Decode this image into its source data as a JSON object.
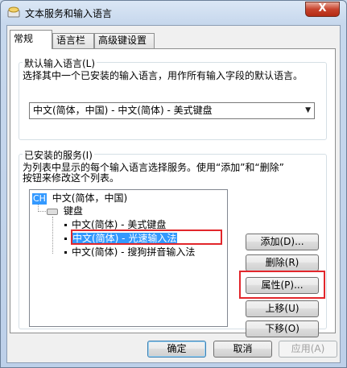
{
  "window": {
    "title": "文本服务和输入语言",
    "close_label": "X"
  },
  "tabs": [
    "常规",
    "语言栏",
    "高级键设置"
  ],
  "default_lang": {
    "legend": "默认输入语言(L)",
    "description": "选择其中一个已安装的输入语言，用作所有输入字段的默认语言。",
    "selected": "中文(简体，中国) - 中文(简体) - 美式键盘"
  },
  "installed": {
    "legend": "已安装的服务(I)",
    "description_line1": "为列表中显示的每个输入语言选择服务。使用“添加”和“删除”",
    "description_line2": "按钮来修改这个列表。",
    "tree": {
      "language_badge": "CH",
      "language": "中文(简体，中国)",
      "category": "键盘",
      "items": [
        "中文(简体) - 美式键盘",
        "中文(简体) - 光速输入法",
        "中文(简体) - 搜狗拼音输入法"
      ]
    },
    "buttons": {
      "add": "添加(D)...",
      "remove": "删除(R)",
      "properties": "属性(P)...",
      "move_up": "上移(U)",
      "move_down": "下移(O)"
    }
  },
  "footer": {
    "ok": "确定",
    "cancel": "取消",
    "apply": "应用(A)"
  },
  "colors": {
    "selection": "#3399ff",
    "highlight_box": "#e2262b"
  }
}
